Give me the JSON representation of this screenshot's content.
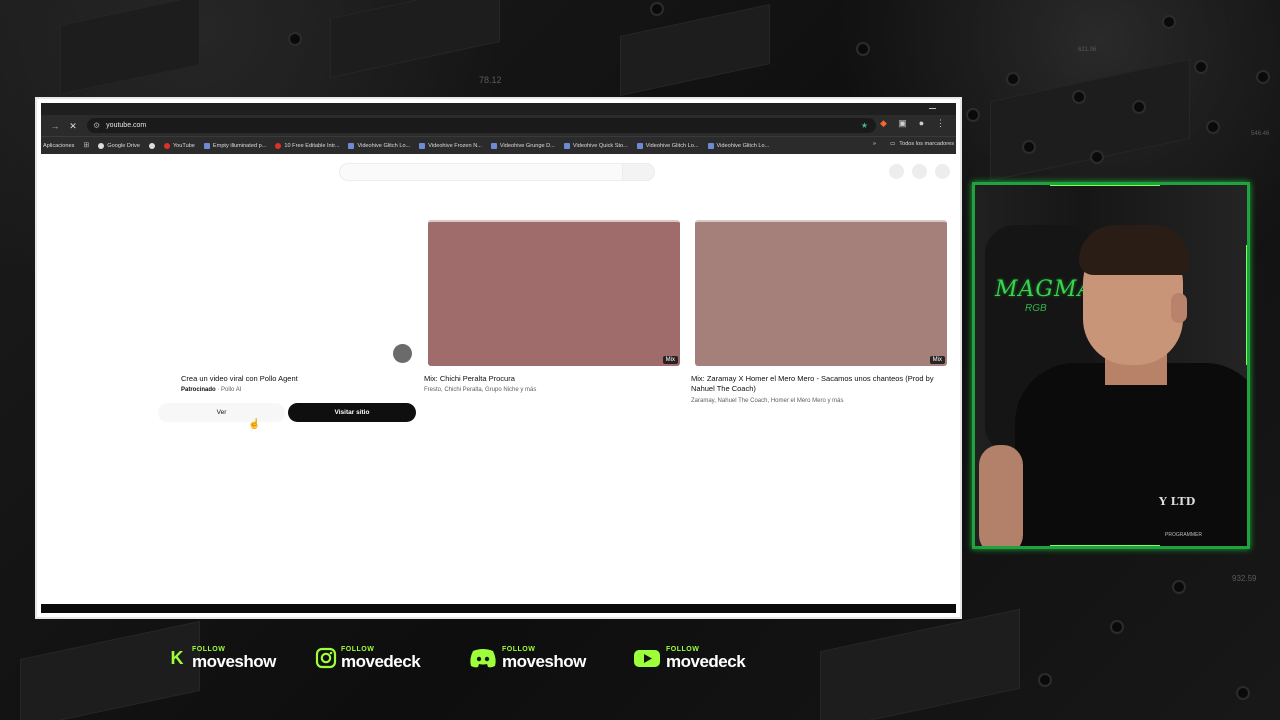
{
  "background": {
    "overlay_numbers": [
      "78.12",
      "621.06",
      "546.46",
      "932.59"
    ]
  },
  "browser": {
    "toolbar": {
      "url": "youtube.com",
      "nav_forward_icon": "forward-arrow-icon",
      "stop_icon": "close-icon"
    },
    "bookmarks": [
      {
        "label": "Aplicaciones",
        "icon": "none"
      },
      {
        "label": "",
        "icon": "apps-grid-icon"
      },
      {
        "label": "Google Drive",
        "icon": "google-icon"
      },
      {
        "label": "",
        "icon": "globe-icon"
      },
      {
        "label": "YouTube",
        "icon": "youtube-icon"
      },
      {
        "label": "Empty illuminated p...",
        "icon": "page-icon"
      },
      {
        "label": "10 Free Editable Intr...",
        "icon": "youtube-icon"
      },
      {
        "label": "Videohive Glitch Lo...",
        "icon": "page-icon"
      },
      {
        "label": "Videohive Frozen N...",
        "icon": "page-icon"
      },
      {
        "label": "Videohive Grunge D...",
        "icon": "page-icon"
      },
      {
        "label": "Videohive Quick Sto...",
        "icon": "page-icon"
      },
      {
        "label": "Videohive Glitch Lo...",
        "icon": "page-icon"
      },
      {
        "label": "Videohive Glitch Lo...",
        "icon": "page-icon"
      }
    ],
    "bookmarks_overflow": "»",
    "all_bookmarks": "Todos los marcadores"
  },
  "page": {
    "ad": {
      "title": "Crea un video viral con Pollo Agent",
      "sponsored": "Patrocinado",
      "advertiser": "Pollo AI",
      "ver_button": "Ver",
      "visit_button": "Visitar sitio"
    },
    "videos": [
      {
        "title": "Mix: Chichi Peralta  Procura",
        "channels": "Fresto, Chichi Peralta, Grupo Niche y más",
        "badge": "Mix",
        "thumb_color": "#a06b6b"
      },
      {
        "title": "Mix: Zaramay X Homer el Mero Mero - Sacamos unos chanteos (Prod by Nahuel The Coach)",
        "channels": "Zaramay, Nahuel The Coach, Homer el Mero Mero y más",
        "badge": "Mix",
        "thumb_color": "#a57f79"
      }
    ]
  },
  "webcam": {
    "chair_brand": "MAGMA",
    "chair_sub": "RGB",
    "shirt_text": "Y LTD",
    "shirt_small": "PROGRAMMER"
  },
  "social": [
    {
      "platform": "kick",
      "follow": "FOLLOW",
      "handle": "moveshow",
      "icon": "kick-icon"
    },
    {
      "platform": "instagram",
      "follow": "FOLLOW",
      "handle": "movedeck",
      "icon": "instagram-icon"
    },
    {
      "platform": "discord",
      "follow": "FOLLOW",
      "handle": "moveshow",
      "icon": "discord-icon"
    },
    {
      "platform": "youtube",
      "follow": "FOLLOW",
      "handle": "movedeck",
      "icon": "youtube-icon"
    }
  ],
  "colors": {
    "accent_green": "#9dff3a",
    "frame_green": "#1fa33c"
  }
}
